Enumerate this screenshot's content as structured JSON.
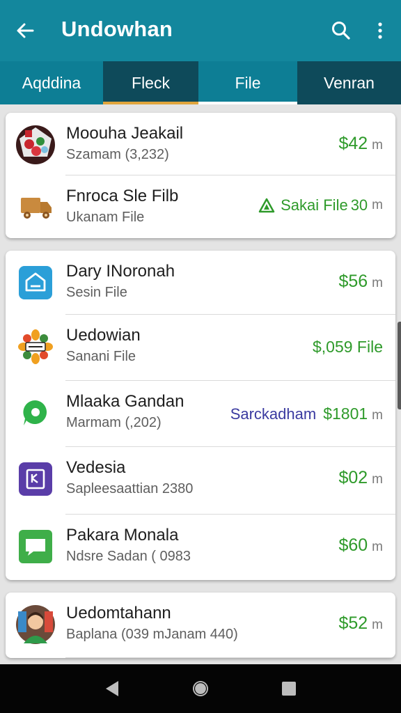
{
  "app_bar": {
    "title": "Undowhan",
    "back_icon": "arrow-left-icon",
    "search_icon": "search-icon",
    "more_icon": "more-vertical-icon",
    "color": "#13879d"
  },
  "tabs": [
    {
      "label": "Aqddina",
      "dark": false,
      "indicator": "none"
    },
    {
      "label": "Fleck",
      "dark": true,
      "indicator": "#e0a53c"
    },
    {
      "label": "File",
      "dark": false,
      "indicator": "#ffffff"
    },
    {
      "label": "Venran",
      "dark": true,
      "indicator": "none"
    }
  ],
  "cards": [
    {
      "rows": [
        {
          "title": "Moouha Jeakail",
          "subtitle": "Szamam (3,232)",
          "price": "$42",
          "unit": "m",
          "icon": "gift-basket-icon"
        },
        {
          "title": "Fnroca Sle Filb",
          "subtitle": "Ukanam File",
          "extra_green": "Sakai File",
          "price": "30",
          "unit": "m",
          "icon": "delivery-truck-icon",
          "trail_icon": "warning-triangle-icon"
        }
      ]
    },
    {
      "rows": [
        {
          "title": "Dary INoronah",
          "subtitle": "Sesin File",
          "price": "$56",
          "unit": "m",
          "icon": "folder-box-icon"
        },
        {
          "title": "Uedowian",
          "subtitle": "Sanani File",
          "price": "$,059 File",
          "unit": "",
          "icon": "sunflower-badge-icon"
        },
        {
          "title": "Mlaaka Gandan",
          "subtitle": "Marmam (,202)",
          "extra": "Sarckadham",
          "price": "$1801",
          "unit": "m",
          "icon": "chat-bubble-icon"
        },
        {
          "title": "Vedesia",
          "subtitle": "Sapleesaattian 2380",
          "price": "$02",
          "unit": "m",
          "icon": "document-app-icon"
        },
        {
          "title": "Pakara Monala",
          "subtitle": "Ndsre Sadan ( 0983",
          "price": "$60",
          "unit": "m",
          "icon": "message-app-icon"
        }
      ]
    },
    {
      "partial": true,
      "rows": [
        {
          "title": "Uedomtahann",
          "subtitle": "Baplana (039 mJanam 440)",
          "price": "$52",
          "unit": "m",
          "icon": "shopkeeper-avatar-icon"
        }
      ]
    }
  ],
  "nav_bar": {
    "back_icon": "nav-back-triangle-icon",
    "home_icon": "nav-home-circle-icon",
    "recents_icon": "nav-recents-square-icon"
  }
}
